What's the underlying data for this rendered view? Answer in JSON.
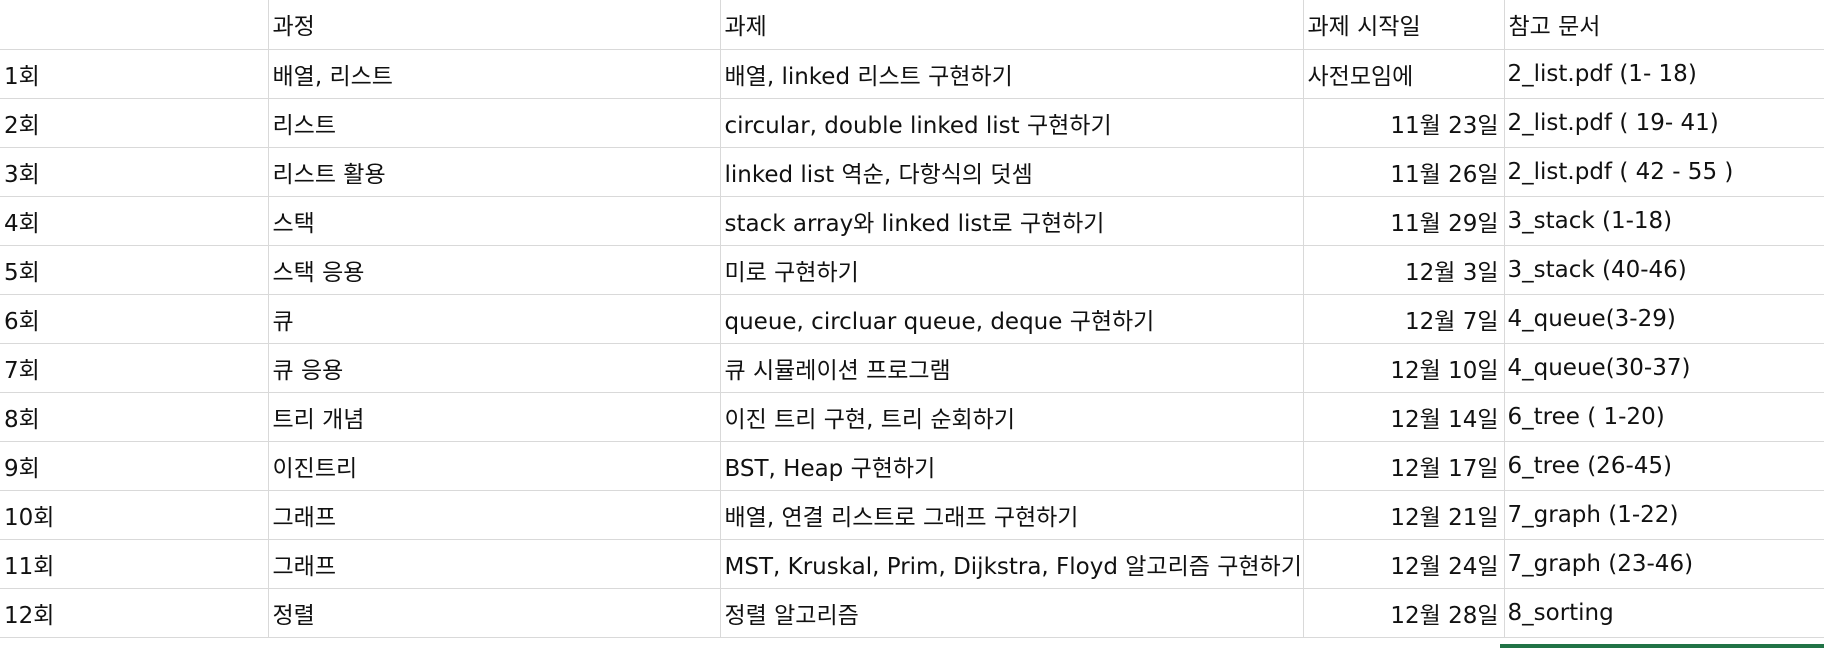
{
  "headers": [
    "",
    "과정",
    "과제",
    "과제 시작일",
    "참고 문서"
  ],
  "rows": [
    [
      "1회",
      "배열, 리스트",
      "배열, linked 리스트 구현하기",
      "사전모임에",
      "2_list.pdf (1- 18)"
    ],
    [
      "2회",
      "리스트",
      "circular, double linked list 구현하기",
      "11월 23일",
      "2_list.pdf ( 19- 41)"
    ],
    [
      "3회",
      "리스트 활용",
      "linked list 역순, 다항식의 덧셈",
      "11월 26일",
      "2_list.pdf ( 42 - 55 )"
    ],
    [
      "4회",
      "스택",
      "stack array와 linked list로 구현하기",
      "11월 29일",
      "3_stack (1-18)"
    ],
    [
      "5회",
      "스택 응용",
      "미로 구현하기",
      "12월 3일",
      "3_stack (40-46)"
    ],
    [
      "6회",
      "큐",
      "queue, circluar queue, deque 구현하기",
      "12월 7일",
      "4_queue(3-29)"
    ],
    [
      "7회",
      "큐 응용",
      "큐 시뮬레이션 프로그램",
      "12월 10일",
      "4_queue(30-37)"
    ],
    [
      "8회",
      "트리 개념",
      "이진 트리 구현, 트리 순회하기",
      "12월 14일",
      "6_tree ( 1-20)"
    ],
    [
      "9회",
      "이진트리",
      "BST, Heap 구현하기",
      "12월 17일",
      "6_tree (26-45)"
    ],
    [
      "10회",
      "그래프",
      "배열, 연결 리스트로  그래프 구현하기",
      "12월 21일",
      "7_graph (1-22)"
    ],
    [
      "11회",
      "그래프",
      "MST, Kruskal, Prim, Dijkstra, Floyd 알고리즘 구현하기",
      "12월 24일",
      "7_graph (23-46)"
    ],
    [
      "12회",
      "정렬",
      "정렬 알고리즘",
      "12월 28일",
      "8_sorting"
    ]
  ]
}
